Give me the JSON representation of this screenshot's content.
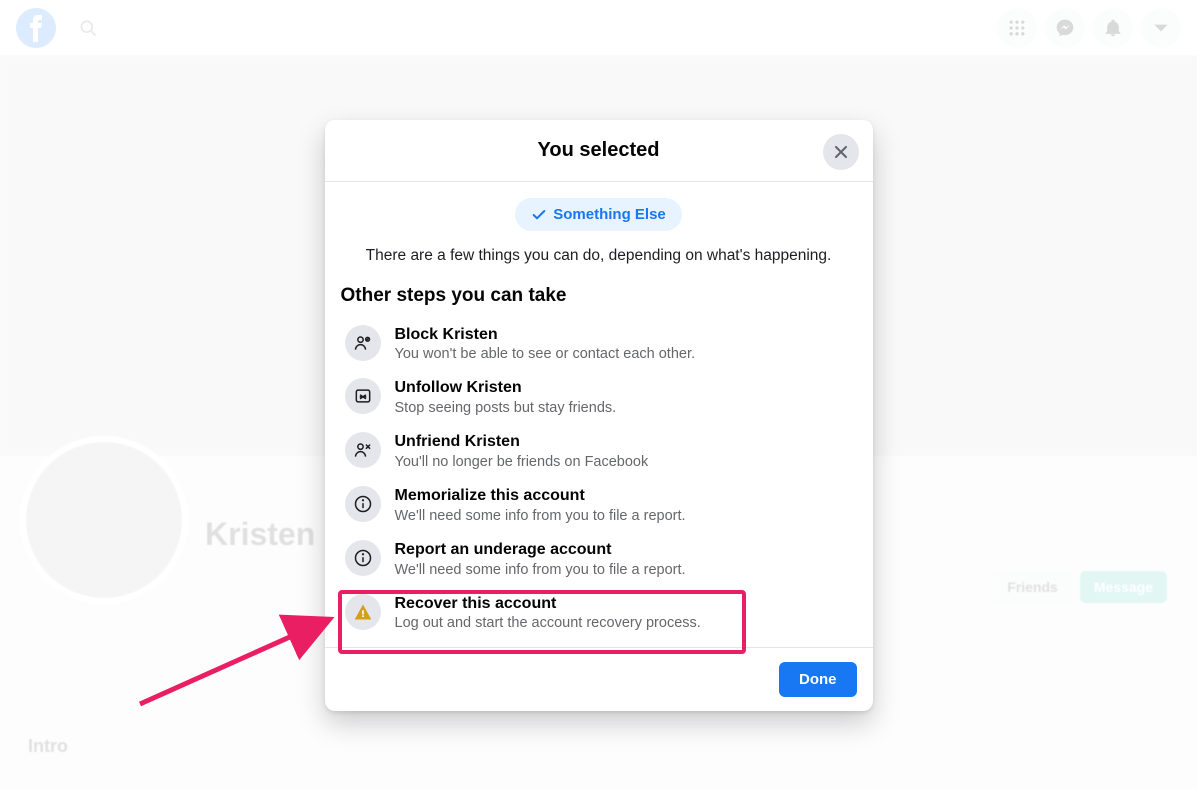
{
  "header": {
    "icons": {
      "menu": "menu-grid-icon",
      "messenger": "messenger-icon",
      "notifications": "bell-icon",
      "account": "chevron-down-icon",
      "search": "search-icon"
    }
  },
  "profile": {
    "name": "Kristen",
    "friends_button": "Friends",
    "message_button": "Message",
    "info_label": "Intro"
  },
  "dialog": {
    "title": "You selected",
    "chip": "Something Else",
    "subtitle": "There are a few things you can do, depending on what's happening.",
    "section_title": "Other steps you can take",
    "options": [
      {
        "title": "Block Kristen",
        "desc": "You won't be able to see or contact each other."
      },
      {
        "title": "Unfollow Kristen",
        "desc": "Stop seeing posts but stay friends."
      },
      {
        "title": "Unfriend Kristen",
        "desc": "You'll no longer be friends on Facebook"
      },
      {
        "title": "Memorialize this account",
        "desc": "We'll need some info from you to file a report."
      },
      {
        "title": "Report an underage account",
        "desc": "We'll need some info from you to file a report."
      },
      {
        "title": "Recover this account",
        "desc": "Log out and start the account recovery process."
      }
    ],
    "done": "Done"
  }
}
